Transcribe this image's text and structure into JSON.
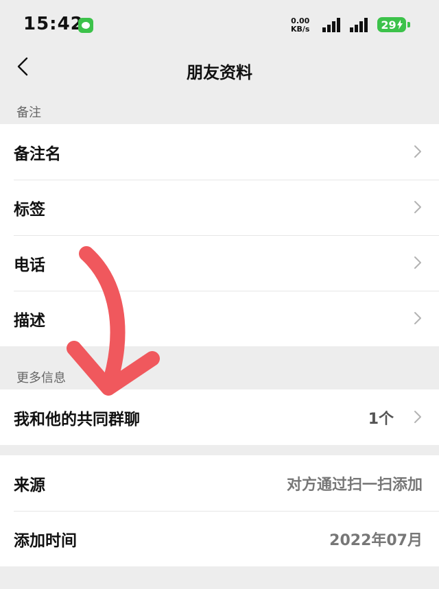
{
  "status_bar": {
    "time": "15:42",
    "net_speed_value": "0.00",
    "net_speed_unit": "KB/s",
    "battery": "29"
  },
  "nav": {
    "title": "朋友资料",
    "back_icon": "chevron-left-icon"
  },
  "section_remark": {
    "title": "备注",
    "items": [
      {
        "label": "备注名"
      },
      {
        "label": "标签"
      },
      {
        "label": "电话"
      },
      {
        "label": "描述"
      }
    ]
  },
  "section_more": {
    "title": "更多信息",
    "items": [
      {
        "label": "我和他的共同群聊",
        "value": "1个"
      }
    ]
  },
  "section_source": {
    "items": [
      {
        "label": "来源",
        "value": "对方通过扫一扫添加"
      },
      {
        "label": "添加时间",
        "value": "2022年07月"
      }
    ]
  },
  "colors": {
    "accent_green": "#3cc24a",
    "annotation_arrow": "#f0585d",
    "background": "#ededed"
  }
}
